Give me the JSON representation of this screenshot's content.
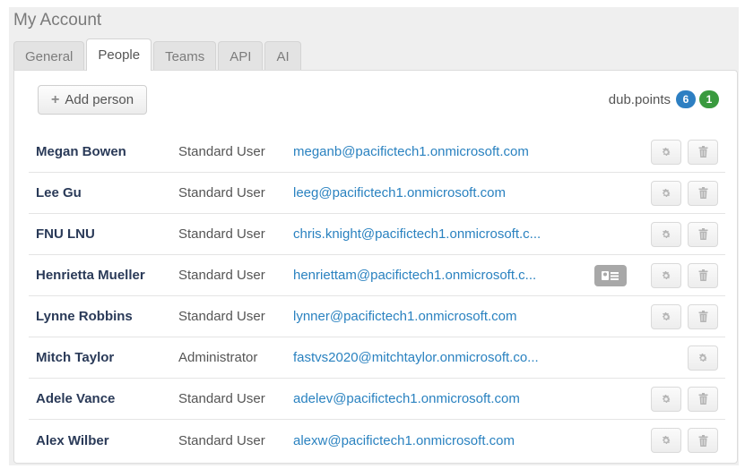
{
  "page": {
    "title": "My Account"
  },
  "tabs": [
    {
      "label": "General",
      "active": false
    },
    {
      "label": "People",
      "active": true
    },
    {
      "label": "Teams",
      "active": false
    },
    {
      "label": "API",
      "active": false
    },
    {
      "label": "AI",
      "active": false
    }
  ],
  "toolbar": {
    "add_person_label": "Add person",
    "add_icon": "plus-icon"
  },
  "points": {
    "label": "dub.points",
    "blue_count": "6",
    "green_count": "1",
    "blue_color": "#2d7fc2",
    "green_color": "#3a9a3f"
  },
  "people": [
    {
      "name": "Megan Bowen",
      "role": "Standard User",
      "email": "meganb@pacifictech1.onmicrosoft.com",
      "actions": [
        "gear-icon",
        "trash-icon"
      ]
    },
    {
      "name": "Lee Gu",
      "role": "Standard User",
      "email": "leeg@pacifictech1.onmicrosoft.com",
      "actions": [
        "gear-icon",
        "trash-icon"
      ]
    },
    {
      "name": "FNU LNU",
      "role": "Standard User",
      "email": "chris.knight@pacifictech1.onmicrosoft.c...",
      "actions": [
        "gear-icon",
        "trash-icon"
      ]
    },
    {
      "name": "Henrietta Mueller",
      "role": "Standard User",
      "email": "henriettam@pacifictech1.onmicrosoft.c...",
      "actions": [
        "contact-card-icon",
        "gear-icon",
        "trash-icon"
      ]
    },
    {
      "name": "Lynne Robbins",
      "role": "Standard User",
      "email": "lynner@pacifictech1.onmicrosoft.com",
      "actions": [
        "gear-icon",
        "trash-icon"
      ]
    },
    {
      "name": "Mitch Taylor",
      "role": "Administrator",
      "email": "fastvs2020@mitchtaylor.onmicrosoft.co...",
      "actions": [
        "gear-icon"
      ]
    },
    {
      "name": "Adele Vance",
      "role": "Standard User",
      "email": "adelev@pacifictech1.onmicrosoft.com",
      "actions": [
        "gear-icon",
        "trash-icon"
      ]
    },
    {
      "name": "Alex Wilber",
      "role": "Standard User",
      "email": "alexw@pacifictech1.onmicrosoft.com",
      "actions": [
        "gear-icon",
        "trash-icon"
      ]
    }
  ]
}
